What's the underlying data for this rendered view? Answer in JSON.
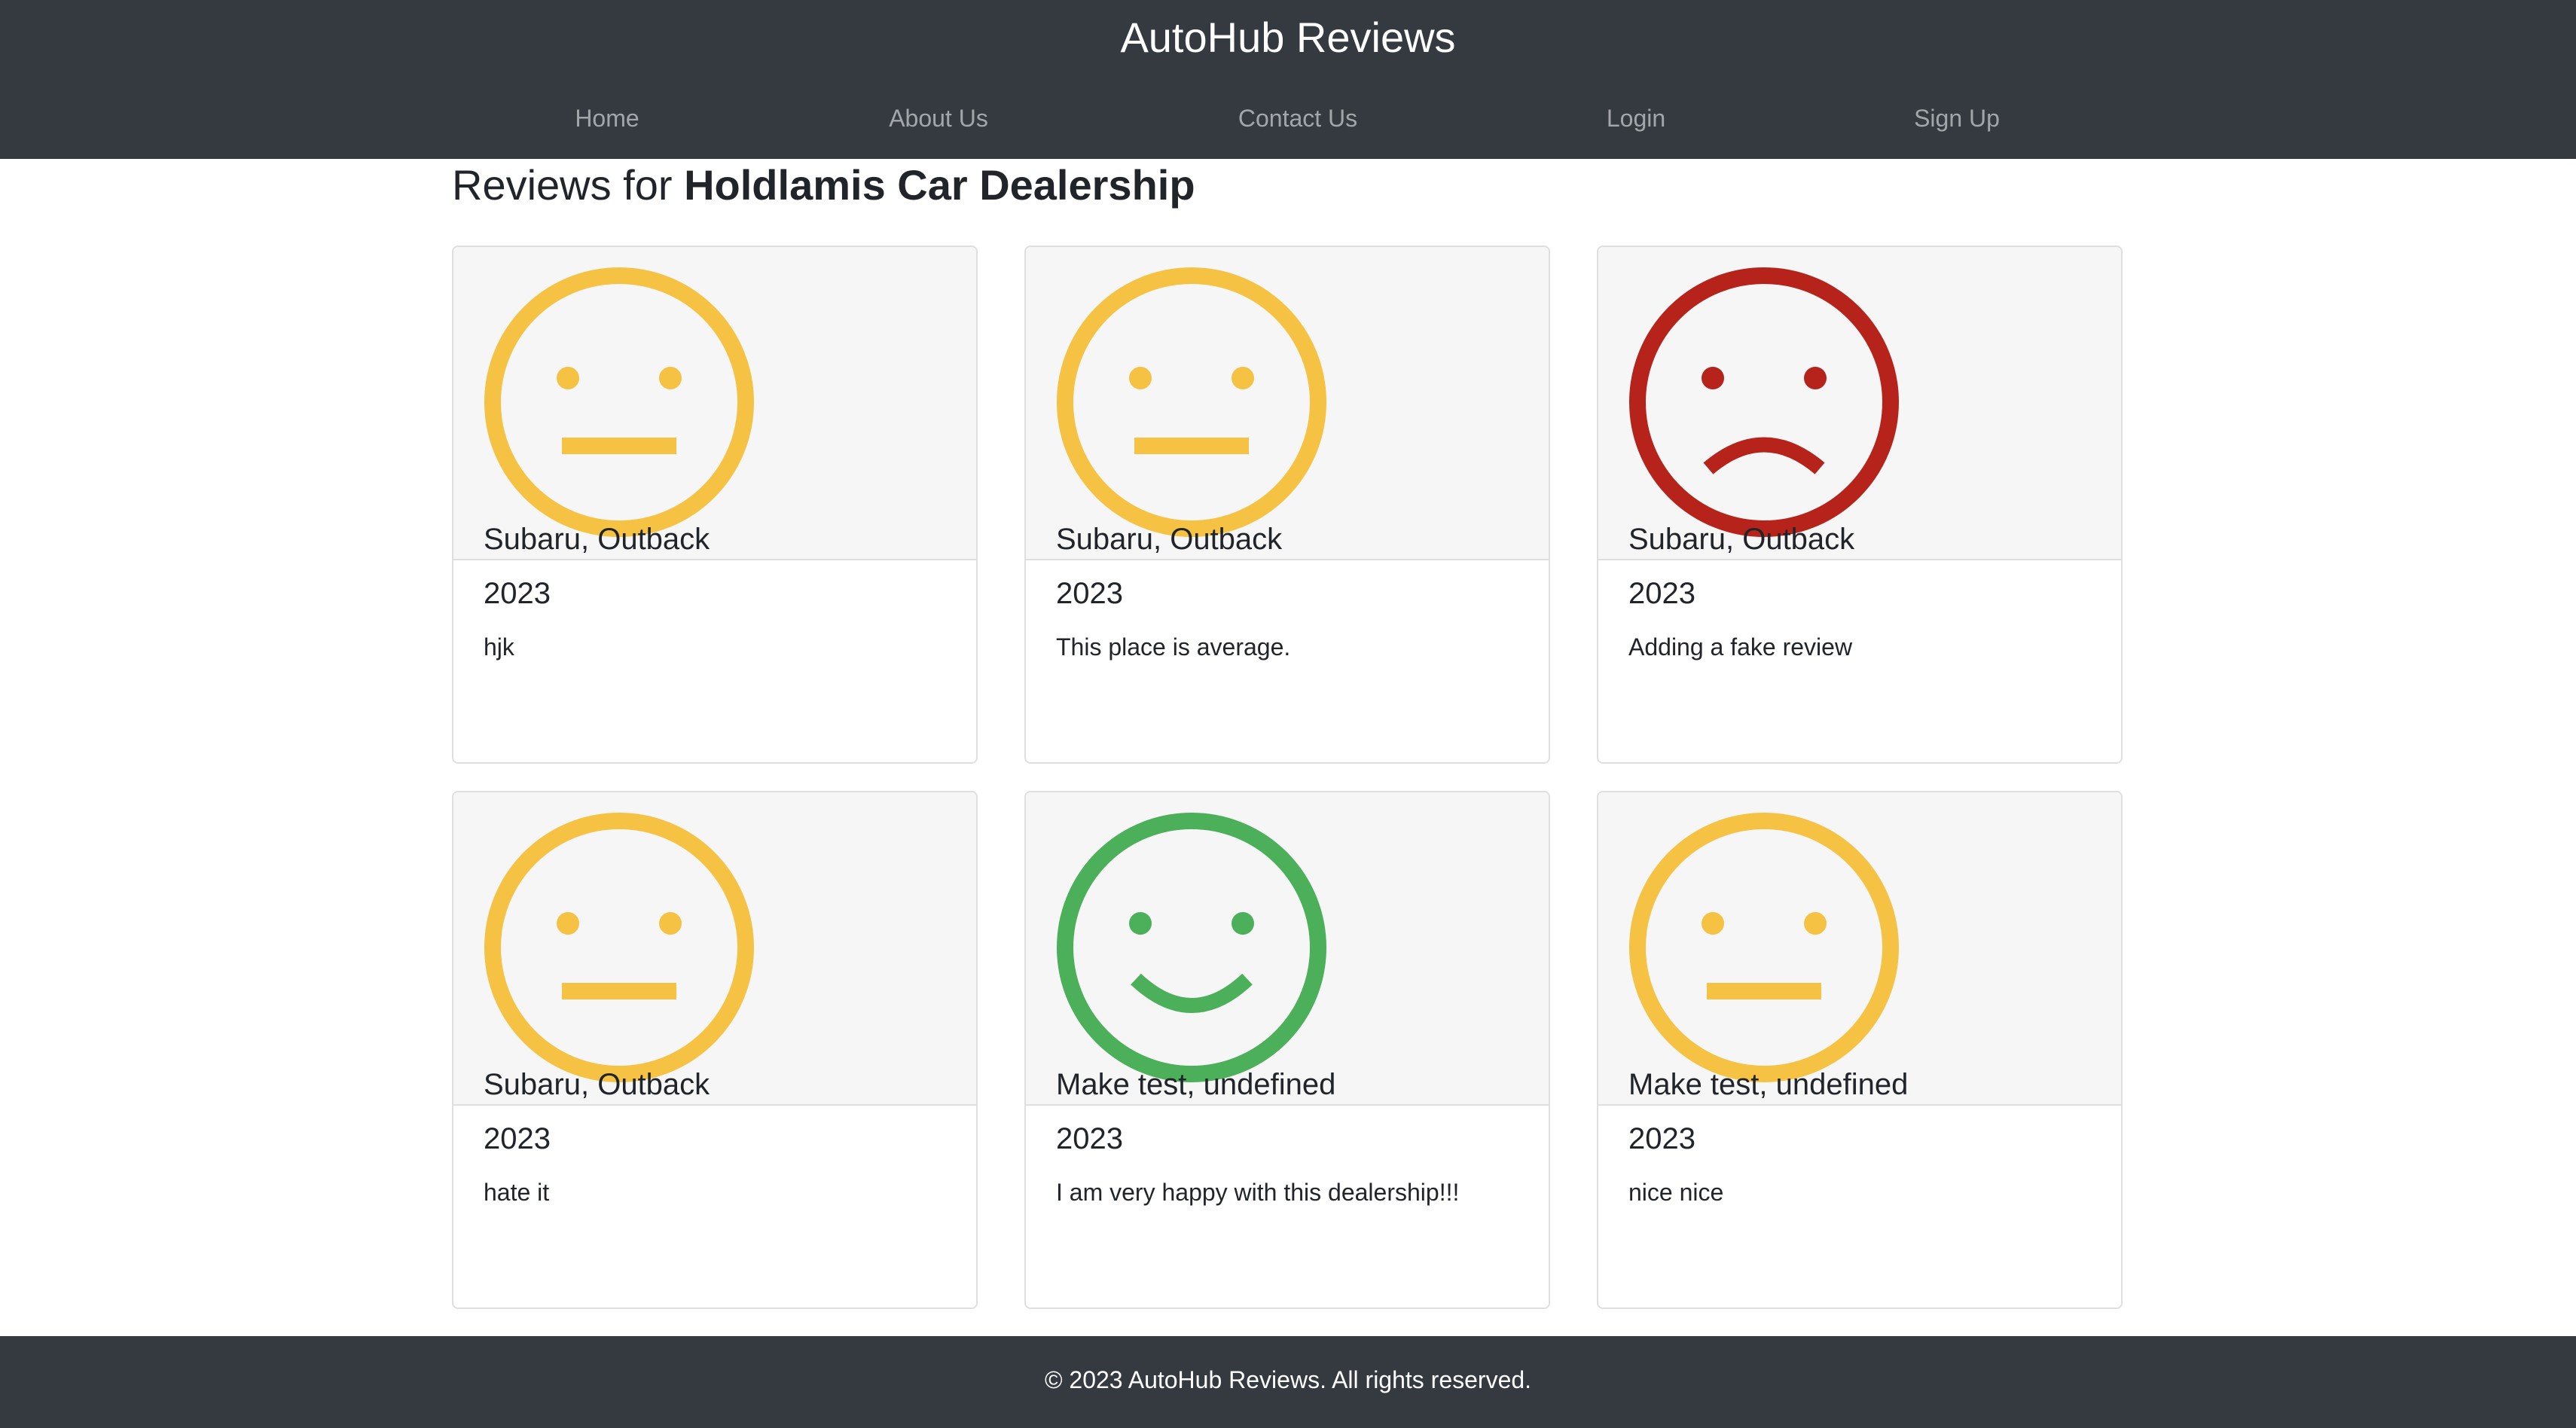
{
  "header": {
    "title": "AutoHub Reviews"
  },
  "nav": [
    {
      "label": "Home"
    },
    {
      "label": "About Us"
    },
    {
      "label": "Contact Us"
    },
    {
      "label": "Login"
    },
    {
      "label": "Sign Up"
    }
  ],
  "heading": {
    "prefix": "Reviews for ",
    "dealer_name": "Holdlamis Car Dealership"
  },
  "reviews": [
    {
      "car": "Subaru, Outback",
      "year": "2023",
      "text": "hjk",
      "sentiment": "neutral",
      "icon": "neutral-face-icon"
    },
    {
      "car": "Subaru, Outback",
      "year": "2023",
      "text": "This place is average.",
      "sentiment": "neutral",
      "icon": "neutral-face-icon"
    },
    {
      "car": "Subaru, Outback",
      "year": "2023",
      "text": "Adding a fake review",
      "sentiment": "negative",
      "icon": "sad-face-icon"
    },
    {
      "car": "Subaru, Outback",
      "year": "2023",
      "text": "hate it",
      "sentiment": "neutral",
      "icon": "neutral-face-icon"
    },
    {
      "car": "Make test, undefined",
      "year": "2023",
      "text": "I am very happy with this dealership!!!",
      "sentiment": "positive",
      "icon": "smile-face-icon"
    },
    {
      "car": "Make test, undefined",
      "year": "2023",
      "text": "nice nice",
      "sentiment": "neutral",
      "icon": "neutral-face-icon"
    }
  ],
  "colors": {
    "neutral": "#f6c244",
    "negative": "#b5231b",
    "positive": "#4caf5a",
    "bar": "#343a40"
  },
  "footer": {
    "text": "© 2023 AutoHub Reviews. All rights reserved."
  }
}
